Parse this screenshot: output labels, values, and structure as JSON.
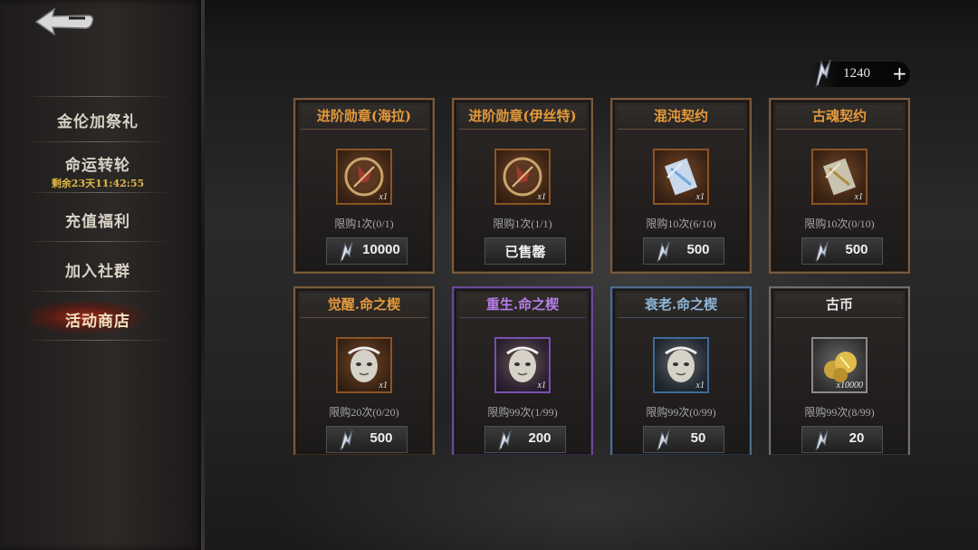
{
  "colors": {
    "orange_title": "#e59a3a",
    "purple_title": "#b67ee8",
    "blue_title": "#8fb6d8",
    "gray_title": "#e6e6e6",
    "active_menu": "#b83020"
  },
  "nav": {
    "back_icon": "back-arrow-icon",
    "items": [
      {
        "label": "金伦加祭礼"
      },
      {
        "label": "命运转轮",
        "sub": "剩余23天11:42:55"
      },
      {
        "label": "充值福利"
      },
      {
        "label": "加入社群"
      },
      {
        "label": "活动商店",
        "active": true
      }
    ]
  },
  "currency": {
    "icon": "crystal-shard-icon",
    "amount": "1240",
    "add_label": "+"
  },
  "shop": {
    "items": [
      {
        "title": "进阶勋章(海拉)",
        "qty": "x1",
        "limit": "限购1次(0/1)",
        "price": "10000",
        "icon": "medal-icon",
        "rarity": "orange"
      },
      {
        "title": "进阶勋章(伊丝特)",
        "qty": "x1",
        "limit": "限购1次(1/1)",
        "price": "已售罄",
        "icon": "medal-icon",
        "rarity": "orange",
        "sold_out": true
      },
      {
        "title": "混沌契约",
        "qty": "x1",
        "limit": "限购10次(6/10)",
        "price": "500",
        "icon": "crystal-contract-icon",
        "rarity": "orange"
      },
      {
        "title": "古魂契约",
        "qty": "x1",
        "limit": "限购10次(0/10)",
        "price": "500",
        "icon": "gold-contract-icon",
        "rarity": "orange"
      },
      {
        "title": "觉醒.命之楔",
        "qty": "x1",
        "limit": "限购20次(0/20)",
        "price": "500",
        "icon": "mask-face-icon",
        "rarity": "orange"
      },
      {
        "title": "重生.命之楔",
        "qty": "x1",
        "limit": "限购99次(1/99)",
        "price": "200",
        "icon": "mask-face-icon",
        "rarity": "purple"
      },
      {
        "title": "衰老.命之楔",
        "qty": "x1",
        "limit": "限购99次(0/99)",
        "price": "50",
        "icon": "mask-face-icon",
        "rarity": "blue"
      },
      {
        "title": "古币",
        "qty": "x10000",
        "limit": "限购99次(8/99)",
        "price": "20",
        "icon": "gold-coins-icon",
        "rarity": "gray"
      }
    ]
  }
}
